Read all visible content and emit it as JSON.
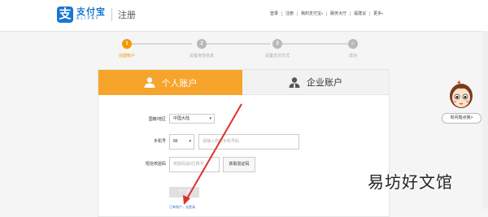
{
  "header": {
    "logo_cn": "支付宝",
    "logo_en": "ALIPAY",
    "title": "注册",
    "nav": [
      "登录",
      "注册",
      "我的支付宝",
      "服务大厅",
      "提建议",
      "更多"
    ]
  },
  "steps": [
    {
      "num": "1",
      "label": "创建账户",
      "active": true
    },
    {
      "num": "2",
      "label": "设置身份信息",
      "active": false
    },
    {
      "num": "3",
      "label": "设置支付方式",
      "active": false
    },
    {
      "num": "✓",
      "label": "成功",
      "active": false
    }
  ],
  "tabs": {
    "personal": "个人账户",
    "company": "企业账户"
  },
  "form": {
    "region_label": "国籍/地区",
    "region_value": "中国大陆",
    "phone_label": "手机号",
    "country_code": "86",
    "phone_placeholder": "请输入你的手机号码",
    "sms_label": "短信校验码",
    "sms_placeholder": "校验码是6位数字",
    "verify_button": "获取验证码",
    "next_button": "下一步",
    "login_link": "已有账户，去登录"
  },
  "floater": {
    "button": "有问题点我>"
  },
  "watermark": "易坊好文馆",
  "colors": {
    "accent": "#f6a42b",
    "brand": "#1677d2",
    "arrow": "#e0302b"
  }
}
